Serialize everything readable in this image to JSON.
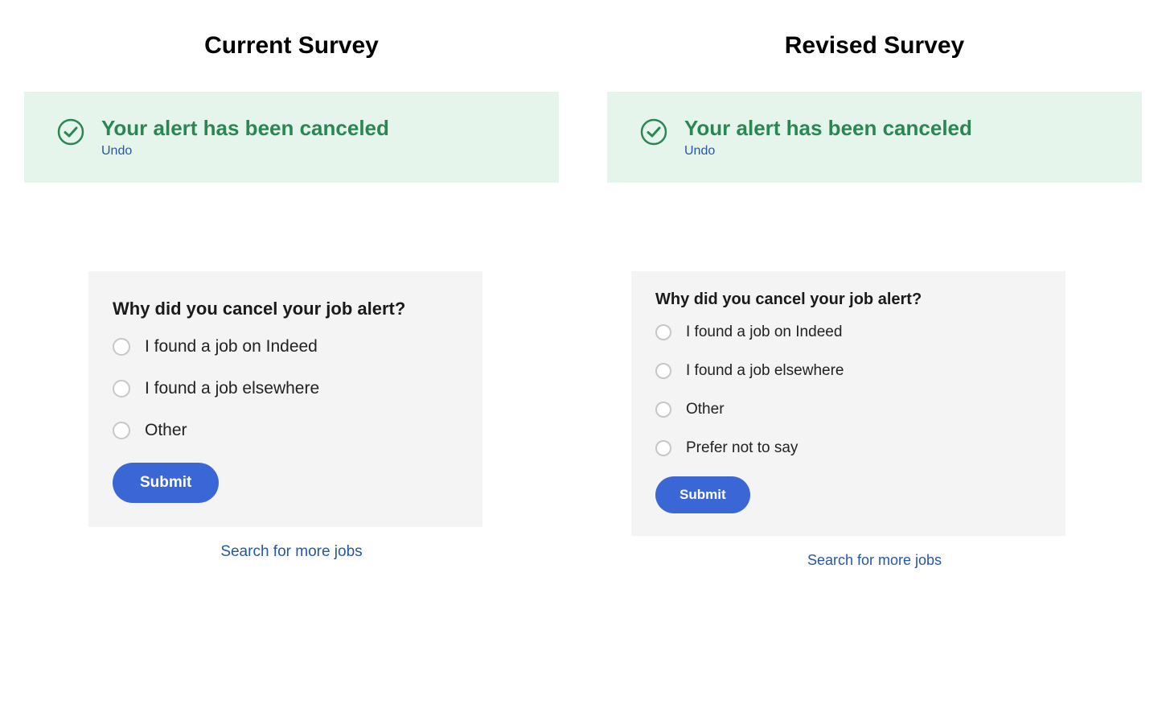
{
  "colors": {
    "accent_blue": "#3b66d6",
    "link_blue": "#2557a7",
    "success_green": "#2a8754",
    "banner_bg": "#e6f5ec",
    "card_bg": "#f4f4f4"
  },
  "current": {
    "title": "Current Survey",
    "banner": {
      "message": "Your alert has been canceled",
      "undo": "Undo"
    },
    "survey": {
      "question": "Why did you cancel your job alert?",
      "options": [
        {
          "label": "I found a job on Indeed"
        },
        {
          "label": "I found a job elsewhere"
        },
        {
          "label": "Other"
        }
      ],
      "submit": "Submit",
      "search_link": "Search for more jobs"
    }
  },
  "revised": {
    "title": "Revised Survey",
    "banner": {
      "message": "Your alert has been canceled",
      "undo": "Undo"
    },
    "survey": {
      "question": "Why did you cancel your job alert?",
      "options": [
        {
          "label": "I found a job on Indeed"
        },
        {
          "label": "I found a job elsewhere"
        },
        {
          "label": "Other"
        },
        {
          "label": "Prefer not to say"
        }
      ],
      "submit": "Submit",
      "search_link": "Search for more jobs"
    }
  }
}
